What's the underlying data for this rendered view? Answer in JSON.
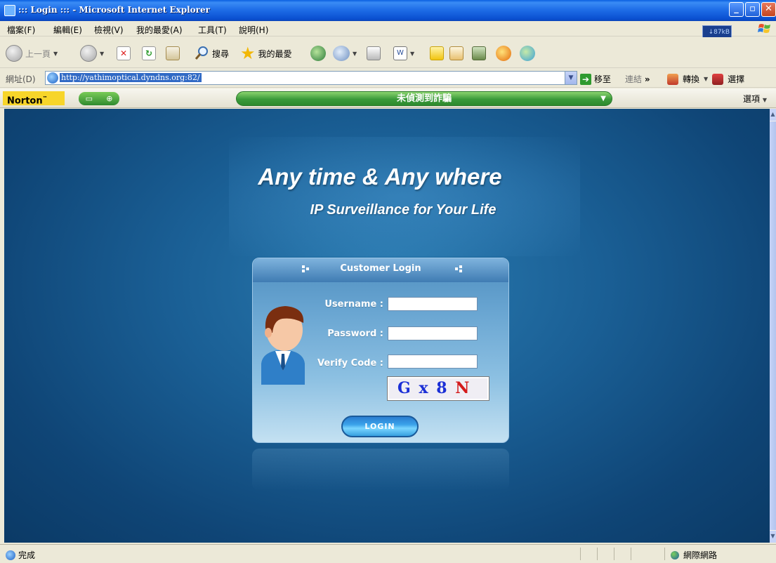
{
  "window": {
    "title": "::: Login ::: - Microsoft Internet Explorer",
    "controls": [
      "minimize",
      "maximize",
      "close"
    ]
  },
  "menu": [
    "檔案(F)",
    "編輯(E)",
    "檢視(V)",
    "我的最愛(A)",
    "工具(T)",
    "說明(H)"
  ],
  "throughput": {
    "label": "↓87kB"
  },
  "toolbar": {
    "back_label": "上一頁",
    "search_label": "搜尋",
    "favorites_label": "我的最愛"
  },
  "address": {
    "label": "網址(D)",
    "url": "http://yathimoptical.dyndns.org:82/",
    "go_label": "移至",
    "links_label": "連結",
    "chevron": "»",
    "convert_label": "轉換",
    "select_label": "選擇"
  },
  "norton": {
    "brand": "Norton",
    "status": "未偵測到詐騙",
    "options_label": "選項"
  },
  "page": {
    "headline": "Any time & Any where",
    "tagline": "IP Surveillance for Your Life",
    "login": {
      "header": "Customer Login",
      "username_label": "Username :",
      "password_label": "Password :",
      "verify_label": "Verify Code :",
      "username_value": "",
      "password_value": "",
      "verify_value": "",
      "captcha": [
        "G",
        "x",
        "8",
        "N"
      ],
      "captcha_colors": [
        "#1b2fd6",
        "#1b2fd6",
        "#1b2fd6",
        "#d41b1b"
      ],
      "button_label": "LOGIN"
    }
  },
  "statusbar": {
    "text": "完成",
    "zone": "網際網路"
  },
  "colors": {
    "titlebar": "#0A4FD0",
    "page_bg": "#1a5f95",
    "norton_status": "#3a9a3a",
    "address_highlight": "#316AC5"
  }
}
